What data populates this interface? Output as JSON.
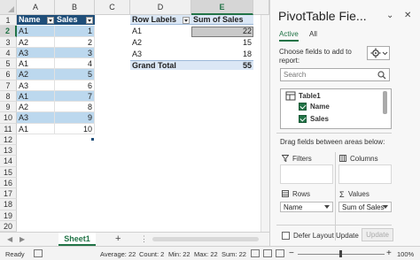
{
  "sheet": {
    "columns": [
      "A",
      "B",
      "C",
      "D",
      "E"
    ],
    "selected_column": "E",
    "rows": [
      "1",
      "2",
      "3",
      "4",
      "5",
      "6",
      "7",
      "8",
      "9",
      "10",
      "11",
      "12",
      "13",
      "14",
      "15",
      "16",
      "17",
      "18",
      "19",
      "20"
    ],
    "selected_row": "2",
    "table": {
      "headers": [
        "Name",
        "Sales"
      ],
      "rows": [
        [
          "A1",
          "1"
        ],
        [
          "A2",
          "2"
        ],
        [
          "A3",
          "3"
        ],
        [
          "A1",
          "4"
        ],
        [
          "A2",
          "5"
        ],
        [
          "A3",
          "6"
        ],
        [
          "A1",
          "7"
        ],
        [
          "A2",
          "8"
        ],
        [
          "A3",
          "9"
        ],
        [
          "A1",
          "10"
        ]
      ]
    },
    "pivot": {
      "header_labels": "Row Labels",
      "header_sum": "Sum of Sales",
      "rows": [
        [
          "A1",
          "22"
        ],
        [
          "A2",
          "15"
        ],
        [
          "A3",
          "18"
        ]
      ],
      "total_label": "Grand Total",
      "total_value": "55"
    }
  },
  "tabs": {
    "sheet_name": "Sheet1",
    "add_label": "+",
    "more": "⋮",
    "prev": "◀",
    "next": "▶"
  },
  "status": {
    "ready": "Ready",
    "average": "Average: 22",
    "count": "Count: 2",
    "min": "Min: 22",
    "max": "Max: 22",
    "sum": "Sum: 22",
    "zoom": "100%",
    "minus": "−",
    "plus": "+"
  },
  "pane": {
    "title": "PivotTable Fie...",
    "dropdown_glyph": "⌄",
    "close_glyph": "✕",
    "tab_active": "Active",
    "tab_all": "All",
    "choose_label": "Choose fields to add to report:",
    "search_placeholder": "Search",
    "table_name": "Table1",
    "fields": [
      "Name",
      "Sales"
    ],
    "drag_label": "Drag fields between areas below:",
    "filters_label": "Filters",
    "columns_label": "Columns",
    "rows_label": "Rows",
    "values_label": "Values",
    "rows_field": "Name",
    "values_field": "Sum of Sales",
    "defer_label": "Defer Layout Update",
    "update_label": "Update"
  },
  "colors": {
    "accent": "#217346",
    "table_header": "#1f4e79",
    "band": "#bcd8ee",
    "pivot_header": "#dbe7f5"
  }
}
